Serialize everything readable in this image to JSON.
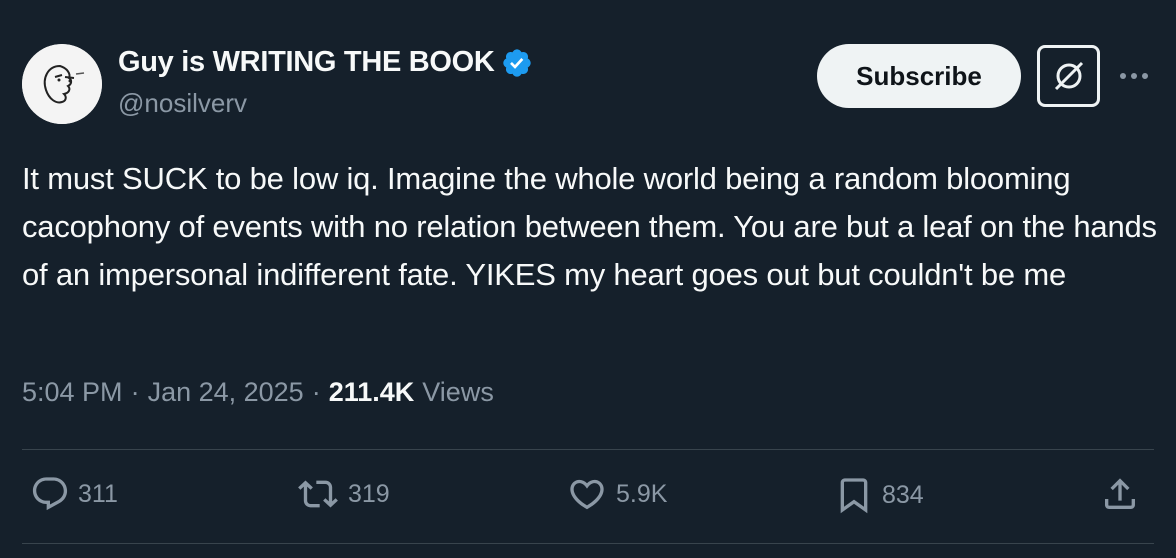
{
  "author": {
    "display_name": "Guy is WRITING THE BOOK",
    "handle": "@nosilverv",
    "verified": true
  },
  "header": {
    "subscribe_label": "Subscribe"
  },
  "tweet": {
    "text": "It must SUCK to be low iq. Imagine the whole world being a random blooming cacophony of events with no relation between them. You are but a leaf on the hands of an impersonal indifferent fate. YIKES my heart goes out but couldn't be me",
    "time": "5:04 PM",
    "separator": "·",
    "date": "Jan 24, 2025",
    "views_count": "211.4K",
    "views_label": "Views"
  },
  "actions": {
    "replies": "311",
    "reposts": "319",
    "likes": "5.9K",
    "bookmarks": "834"
  },
  "colors": {
    "background": "#15202b",
    "text_primary": "#f7f9f9",
    "text_secondary": "#8b98a5",
    "verified_blue": "#1d9bf0",
    "divider": "#38444d"
  },
  "icons": {
    "reply": "reply-icon",
    "repost": "repost-icon",
    "like": "heart-icon",
    "bookmark": "bookmark-icon",
    "share": "share-icon",
    "grok": "grok-icon",
    "more": "more-icon",
    "verified": "verified-badge-icon"
  }
}
